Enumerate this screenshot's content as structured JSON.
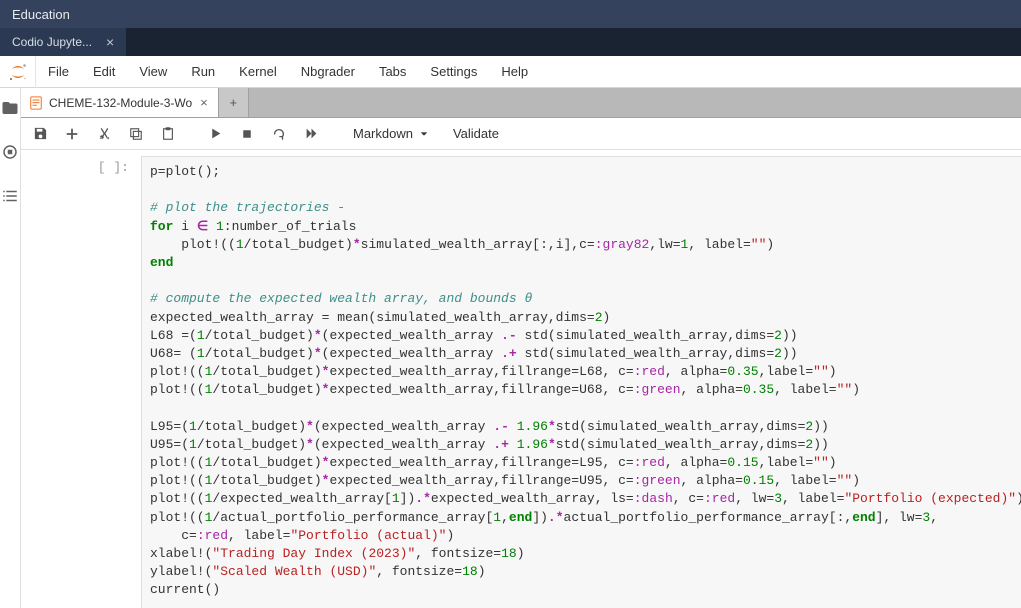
{
  "title_bar": {
    "text": "Education"
  },
  "app_tab": {
    "label": "Codio Jupyte..."
  },
  "menu": {
    "file": "File",
    "edit": "Edit",
    "view": "View",
    "run": "Run",
    "kernel": "Kernel",
    "nbgrader": "Nbgrader",
    "tabs": "Tabs",
    "settings": "Settings",
    "help": "Help"
  },
  "nb_tab": {
    "label": "CHEME-132-Module-3-Wo"
  },
  "toolbar": {
    "cell_type": "Markdown",
    "validate": "Validate"
  },
  "cell": {
    "prompt": "[ ]:",
    "code": {
      "l1": "p=plot();",
      "l2": "",
      "l3": "# plot the trajectories -",
      "l4a": "for",
      "l4b": " i ",
      "l4c": "∈",
      "l4d": " ",
      "l4e": "1",
      "l4f": ":number_of_trials",
      "l5a": "    plot!((",
      "l5b": "1",
      "l5c": "/total_budget)",
      "l5d": "*",
      "l5e": "simulated_wealth_array[:,i],c=",
      "l5f": ":gray82",
      "l5g": ",lw=",
      "l5h": "1",
      "l5i": ", label=",
      "l5j": "\"\"",
      "l5k": ")",
      "l6": "end",
      "l7": "",
      "l8": "# compute the expected wealth array, and bounds θ",
      "l9a": "expected_wealth_array = mean(simulated_wealth_array,dims=",
      "l9b": "2",
      "l9c": ")",
      "l10a": "L68 =(",
      "l10b": "1",
      "l10c": "/total_budget)",
      "l10d": "*",
      "l10e": "(expected_wealth_array ",
      "l10f": ".-",
      "l10g": " std(simulated_wealth_array,dims=",
      "l10h": "2",
      "l10i": "))",
      "l11a": "U68= (",
      "l11b": "1",
      "l11c": "/total_budget)",
      "l11d": "*",
      "l11e": "(expected_wealth_array ",
      "l11f": ".+",
      "l11g": " std(simulated_wealth_array,dims=",
      "l11h": "2",
      "l11i": "))",
      "l12a": "plot!((",
      "l12b": "1",
      "l12c": "/total_budget)",
      "l12d": "*",
      "l12e": "expected_wealth_array,fillrange=L68, c=",
      "l12f": ":red",
      "l12g": ", alpha=",
      "l12h": "0.35",
      "l12i": ",label=",
      "l12j": "\"\"",
      "l12k": ")",
      "l13a": "plot!((",
      "l13b": "1",
      "l13c": "/total_budget)",
      "l13d": "*",
      "l13e": "expected_wealth_array,fillrange=U68, c=",
      "l13f": ":green",
      "l13g": ", alpha=",
      "l13h": "0.35",
      "l13i": ", label=",
      "l13j": "\"\"",
      "l13k": ")",
      "l14": "",
      "l15a": "L95=(",
      "l15b": "1",
      "l15c": "/total_budget)",
      "l15d": "*",
      "l15e": "(expected_wealth_array ",
      "l15f": ".-",
      "l15g": " ",
      "l15h": "1.96",
      "l15i": "*",
      "l15j": "std(simulated_wealth_array,dims=",
      "l15k": "2",
      "l15l": "))",
      "l16a": "U95=(",
      "l16b": "1",
      "l16c": "/total_budget)",
      "l16d": "*",
      "l16e": "(expected_wealth_array ",
      "l16f": ".+",
      "l16g": " ",
      "l16h": "1.96",
      "l16i": "*",
      "l16j": "std(simulated_wealth_array,dims=",
      "l16k": "2",
      "l16l": "))",
      "l17a": "plot!((",
      "l17b": "1",
      "l17c": "/total_budget)",
      "l17d": "*",
      "l17e": "expected_wealth_array,fillrange=L95, c=",
      "l17f": ":red",
      "l17g": ", alpha=",
      "l17h": "0.15",
      "l17i": ",label=",
      "l17j": "\"\"",
      "l17k": ")",
      "l18a": "plot!((",
      "l18b": "1",
      "l18c": "/total_budget)",
      "l18d": "*",
      "l18e": "expected_wealth_array,fillrange=U95, c=",
      "l18f": ":green",
      "l18g": ", alpha=",
      "l18h": "0.15",
      "l18i": ", label=",
      "l18j": "\"\"",
      "l18k": ")",
      "l19a": "plot!((",
      "l19b": "1",
      "l19c": "/expected_wealth_array[",
      "l19d": "1",
      "l19e": "])",
      "l19f": ".*",
      "l19g": "expected_wealth_array, ls=",
      "l19h": ":dash",
      "l19i": ", c=",
      "l19j": ":red",
      "l19k": ", lw=",
      "l19l": "3",
      "l19m": ", label=",
      "l19n": "\"Portfolio (expected)\"",
      "l19o": ")",
      "l20a": "plot!((",
      "l20b": "1",
      "l20c": "/actual_portfolio_performance_array[",
      "l20d": "1",
      "l20e": ",",
      "l20f": "end",
      "l20g": "])",
      "l20h": ".*",
      "l20i": "actual_portfolio_performance_array[:,",
      "l20j": "end",
      "l20k": "], lw=",
      "l20l": "3",
      "l20m": ", ",
      "l21a": "    c=",
      "l21b": ":red",
      "l21c": ", label=",
      "l21d": "\"Portfolio (actual)\"",
      "l21e": ")",
      "l22a": "xlabel!(",
      "l22b": "\"Trading Day Index (2023)\"",
      "l22c": ", fontsize=",
      "l22d": "18",
      "l22e": ")",
      "l23a": "ylabel!(",
      "l23b": "\"Scaled Wealth (USD)\"",
      "l23c": ", fontsize=",
      "l23d": "18",
      "l23e": ")",
      "l24": "current()"
    }
  }
}
